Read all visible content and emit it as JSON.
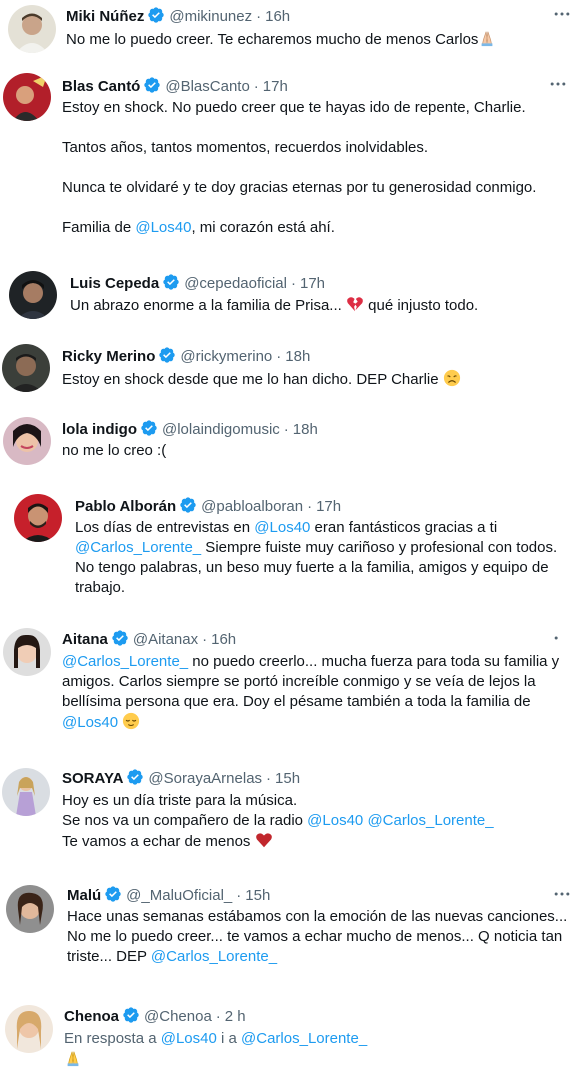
{
  "tweets": [
    {
      "name": "Miki Núñez",
      "handle": "@mikinunez",
      "time": "16h",
      "line1": "No me lo puedo creer. Te echaremos mucho de menos Carlos",
      "emoji": "folded-hands-emoji"
    },
    {
      "name": "Blas Cantó",
      "handle": "@BlasCanto",
      "time": "17h",
      "line1": "Estoy en shock. No puedo creer que te hayas ido de repente, Charlie.",
      "line2": "Tantos años, tantos momentos, recuerdos inolvidables.",
      "line3": "Nunca te olvidaré y te doy gracias eternas por tu generosidad conmigo.",
      "line4a": "Familia de ",
      "line4b": "@Los40",
      "line4c": ", mi corazón está ahí."
    },
    {
      "name": "Luis Cepeda",
      "handle": "@cepedaoficial",
      "time": "17h",
      "line1a": "Un abrazo enorme a la familia de Prisa... ",
      "line1b": " qué injusto todo.",
      "emoji": "broken-heart-emoji"
    },
    {
      "name": "Ricky Merino",
      "handle": "@rickymerino",
      "time": "18h",
      "line1": "Estoy en shock desde que me lo han dicho. DEP Charlie",
      "emoji": "disappointed-face-emoji"
    },
    {
      "name": "lola indigo",
      "handle": "@lolaindigomusic",
      "time": "18h",
      "line1": "no me lo creo :("
    },
    {
      "name": "Pablo Alborán",
      "handle": "@pabloalboran",
      "time": "17h",
      "line1a": "Los días de entrevistas en ",
      "line1b": "@Los40",
      "line1c": " eran fantásticos gracias a ti",
      "line2a": "@Carlos_Lorente_",
      "line2b": " Siempre fuiste muy cariñoso y profesional con todos.",
      "line3": "No tengo palabras, un beso muy fuerte a la familia, amigos y equipo de",
      "line4": "trabajo."
    },
    {
      "name": "Aitana",
      "handle": "@Aitanax",
      "time": "16h",
      "line1a": "@Carlos_Lorente_",
      "line1b": " no puedo creerlo... mucha fuerza para toda su familia y",
      "line2": "amigos. Carlos siempre se portó increíble conmigo y se veía de lejos la",
      "line3": "bellísima persona que era. Doy el pésame también a toda la familia de",
      "line4a": "@Los40",
      "emoji": "relieved-face-emoji"
    },
    {
      "name": "SORAYA",
      "handle": "@SorayaArnelas",
      "time": "15h",
      "line1": "Hoy es un día triste para la música.",
      "line2a": "Se nos va un compañero de la radio ",
      "line2b": "@Los40",
      "line2c": " ",
      "line2d": "@Carlos_Lorente_",
      "line3": "Te vamos a echar de menos",
      "emoji": "red-heart-emoji"
    },
    {
      "name": "Malú",
      "handle": "@_MaluOficial_",
      "time": "15h",
      "line1": "Hace unas semanas estábamos con la emoción de las nuevas canciones...",
      "line2": "No me lo puedo creer... te vamos a echar mucho de menos... Q noticia tan",
      "line3a": "triste... DEP ",
      "line3b": "@Carlos_Lorente_"
    },
    {
      "name": "Chenoa",
      "handle": "@Chenoa",
      "time": "2 h",
      "line1a": "En resposta a ",
      "line1b": "@Los40",
      "line1c": " i a ",
      "line1d": "@Carlos_Lorente_",
      "emoji": "folded-hands-emoji"
    }
  ],
  "colors": {
    "link": "#1d9bf0",
    "verified": "#1d9bf0",
    "muted": "#536471",
    "text": "#0f1419"
  }
}
